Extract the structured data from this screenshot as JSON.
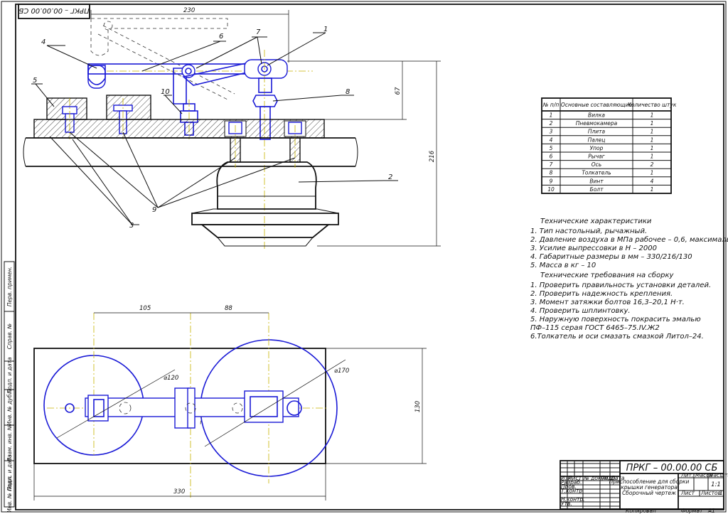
{
  "doc_code": "ПРКГ – 00.00.00 СБ",
  "doc_code_rotated": "ПРКГ – 00.00.00 СБ",
  "callouts": [
    "1",
    "2",
    "3",
    "4",
    "5",
    "6",
    "7",
    "8",
    "9",
    "10"
  ],
  "dimensions": {
    "top_width": "230",
    "right_height": "216",
    "mid_height": "67",
    "plan_105": "105",
    "plan_88": "88",
    "plan_dia_small": "⌀120",
    "plan_dia_large": "⌀170",
    "plan_height": "130",
    "plan_width": "330"
  },
  "parts_table": {
    "headers": [
      "№ п/п",
      "Основные составляющие",
      "Количество штук"
    ],
    "rows": [
      [
        "1",
        "Вилка",
        "1"
      ],
      [
        "2",
        "Пневмокамера",
        "1"
      ],
      [
        "3",
        "Плита",
        "1"
      ],
      [
        "4",
        "Палец",
        "1"
      ],
      [
        "5",
        "Упор",
        "1"
      ],
      [
        "6",
        "Рычаг",
        "1"
      ],
      [
        "7",
        "Ось",
        "2"
      ],
      [
        "8",
        "Толкатель",
        "1"
      ],
      [
        "9",
        "Винт",
        "4"
      ],
      [
        "10",
        "Болт",
        "1"
      ]
    ]
  },
  "tech_specs": {
    "title": "Технические характеристики",
    "items": [
      "1. Тип настольный, рычажный.",
      "2. Давление воздуха в МПа рабочее – 0,6, максимальное – 1,0",
      "3. Усилие выпрессовки в Н – 2000",
      "4. Габаритные размеры в мм – 330/216/130",
      "5. Масса в кг – 10"
    ]
  },
  "assembly_reqs": {
    "title": "Технические требования на сборку",
    "items": [
      "1. Проверить правильность установки деталей.",
      "2. Проверить надежность крепления.",
      "3. Момент затяжки болтов 16,3–20,1 Н·т.",
      "4. Проверить шплинтовку.",
      "5. Наружную поверхность покрасить эмалью",
      "ПФ–115 серая ГОСТ 6465–75.IV.Ж2",
      "6.Толкатель и оси смазать смазкой Литол–24."
    ]
  },
  "title_block": {
    "code": "ПРКГ – 00.00.00 СБ",
    "name_lines": [
      "Приспособление для сборки",
      "крышки генератора",
      "Сборочный чертеж"
    ],
    "col_headers": [
      "Изм",
      "Лист",
      "№ докум.",
      "Подп.",
      "Дата"
    ],
    "roles": [
      "Разраб.",
      "Пров.",
      "Т.контр.",
      "",
      "Н.контр.",
      "Утв."
    ],
    "lit_label": "Лит.",
    "mass_label": "Масса",
    "scale_label": "Масштаб",
    "scale_value": "1:1",
    "sheet_label": "Лист",
    "sheets_label": "Листов",
    "sheets_value": "1"
  },
  "footer": {
    "copied": "Копировал",
    "format": "Формат",
    "format_value": "А1"
  },
  "side_strip": [
    "Перв. примен.",
    "Справ. №",
    "Подп. и дата",
    "Инв. № дубл.",
    "Взам. инв. №",
    "Подп. и дата",
    "Инв. № подл."
  ]
}
